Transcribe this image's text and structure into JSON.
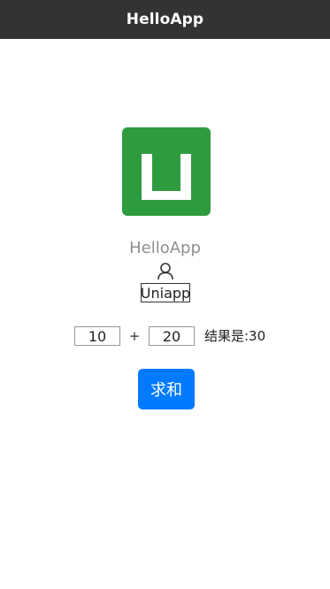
{
  "navbar": {
    "title": "HelloApp"
  },
  "app": {
    "name": "HelloApp",
    "logo_icon": "uniapp-logo-icon",
    "logo_color": "#2f9b3f"
  },
  "user": {
    "icon": "user-icon",
    "label": "Uniapp"
  },
  "calculator": {
    "first_value": "10",
    "operator": "+",
    "second_value": "20",
    "result_text": "结果是:30",
    "button_label": "求和",
    "button_color": "#007aff"
  }
}
